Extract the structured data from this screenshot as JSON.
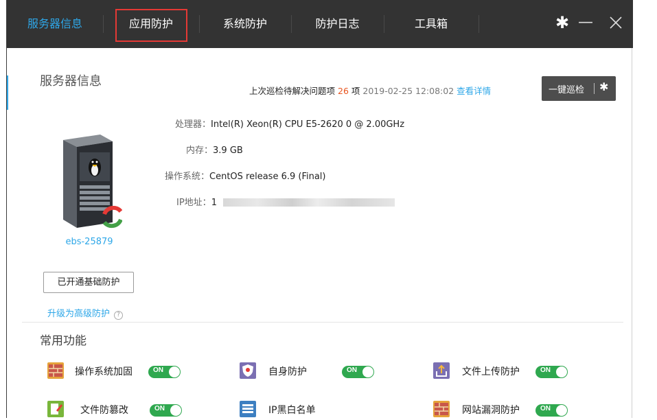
{
  "tabs": [
    {
      "label": "服务器信息",
      "active": true
    },
    {
      "label": "应用防护",
      "active": false
    },
    {
      "label": "系统防护",
      "active": false
    },
    {
      "label": "防护日志",
      "active": false
    },
    {
      "label": "工具箱",
      "active": false
    }
  ],
  "window_controls": {
    "settings_icon": "gear-icon",
    "minimize_icon": "minimize-icon",
    "close_icon": "close-icon"
  },
  "colors": {
    "topbar": "#333333",
    "accent": "#2ea7e8",
    "toggle_on": "#2fa84f",
    "warning": "#e8541e",
    "highlight_box": "#e53935"
  },
  "section_title": "服务器信息",
  "last_check": {
    "prefix": "上次巡检待解决问题项",
    "count": "26",
    "unit": "项",
    "datetime": "2019-02-25 12:08:02",
    "details_link": "查看详情"
  },
  "onekey_check_label": "一键巡检",
  "server": {
    "cpu_label": "处理器：",
    "cpu": "Intel(R) Xeon(R) CPU E5-2620 0 @ 2.00GHz",
    "mem_label": "内存：",
    "mem": "3.9 GB",
    "os_label": "操作系统：",
    "os": "CentOS release 6.9 (Final)",
    "ip_label": "IP地址：",
    "ip_first_char": "1"
  },
  "host_name": "ebs-25879",
  "basic_protection_button": "已开通基础防护",
  "upgrade_link": "升级为高级防护",
  "help_glyph": "?",
  "common_title": "常用功能",
  "features": [
    {
      "name": "操作系统加固",
      "toggle": "ON",
      "icon": "brick-wall-icon"
    },
    {
      "name": "自身防护",
      "toggle": "ON",
      "icon": "shield-icon"
    },
    {
      "name": "文件上传防护",
      "toggle": "ON",
      "icon": "upload-icon"
    },
    {
      "name": "文件防篡改",
      "toggle": "ON",
      "icon": "edit-document-icon"
    },
    {
      "name": "IP黑白名单",
      "toggle": "",
      "icon": "list-icon"
    },
    {
      "name": "网站漏洞防护",
      "toggle": "ON",
      "icon": "brick-wall-icon"
    }
  ]
}
